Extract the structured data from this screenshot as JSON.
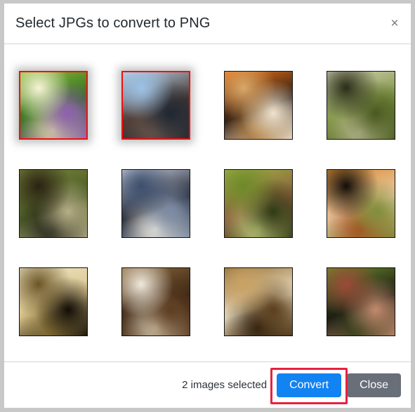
{
  "window": {
    "frame_color": "#c8c8c8",
    "background": "#ffffff"
  },
  "header": {
    "title": "Select JPGs to convert to PNG",
    "close_icon": "×",
    "close_icon_name": "close-icon",
    "separator_color": "#d5d5d5"
  },
  "body": {
    "columns": 4,
    "rows": 3,
    "thumbnails": [
      {
        "index": 1,
        "alt": "purple flower spike with green foliage",
        "selected": true,
        "palette": [
          "#f7f3d8",
          "#8bbf3a",
          "#2f6b1d",
          "#8e5fb0",
          "#dcd7a6"
        ]
      },
      {
        "index": 2,
        "alt": "cormorant bird perched in bare tree against blue sky",
        "selected": true,
        "palette": [
          "#9cc2e6",
          "#b8d2ea",
          "#4a3a33",
          "#1d2733",
          "#6f5a4e"
        ]
      },
      {
        "index": 3,
        "alt": "orange fruit on reflective table in blurred interior",
        "selected": false,
        "palette": [
          "#d8a86a",
          "#f07818",
          "#2a1a12",
          "#efe3cf",
          "#b07c3c"
        ]
      },
      {
        "index": 4,
        "alt": "fountain in a pond with grassy banks",
        "selected": false,
        "palette": [
          "#2a2d18",
          "#d8d6bc",
          "#7d9240",
          "#49591f",
          "#bcbb94"
        ]
      },
      {
        "index": 5,
        "alt": "wooded pond with dark tree trunks",
        "selected": false,
        "palette": [
          "#2a2213",
          "#79853c",
          "#4c5b26",
          "#b6ae86",
          "#1a1a14"
        ]
      },
      {
        "index": 6,
        "alt": "sun behind bare branches over water at dusk",
        "selected": false,
        "palette": [
          "#3c4f6e",
          "#cfd6e4",
          "#1d2230",
          "#7d8ca5",
          "#f4efe2"
        ]
      },
      {
        "index": 7,
        "alt": "green reed stems over brick wall",
        "selected": false,
        "palette": [
          "#6e8a2a",
          "#9fb545",
          "#8b5e3c",
          "#2f3a15",
          "#c4cf7e"
        ]
      },
      {
        "index": 8,
        "alt": "grilled salmon with vegetables on dark plate",
        "selected": false,
        "palette": [
          "#120d08",
          "#d98b33",
          "#e8c9a0",
          "#7f8f3a",
          "#a8471c"
        ]
      },
      {
        "index": 9,
        "alt": "pendant lamp shade glowing in dark room",
        "selected": false,
        "palette": [
          "#6a5526",
          "#f0e6c6",
          "#d9c58e",
          "#120d06",
          "#8a7236"
        ]
      },
      {
        "index": 10,
        "alt": "wooden chair leg and seat close-up",
        "selected": false,
        "palette": [
          "#efe9dd",
          "#8c6a3c",
          "#3b2414",
          "#5e3d20",
          "#d6c9ae"
        ]
      },
      {
        "index": 11,
        "alt": "stacked pages of an open old book",
        "selected": false,
        "palette": [
          "#c9a264",
          "#8f6a32",
          "#efe2c4",
          "#5c3f1c",
          "#2a1c0c"
        ]
      },
      {
        "index": 12,
        "alt": "lizard on a brick ledge with green grass behind",
        "selected": false,
        "palette": [
          "#9b4b38",
          "#6f8d2c",
          "#1a1a14",
          "#c28a6c",
          "#2b3a16"
        ]
      }
    ]
  },
  "footer": {
    "selection_count_text": "2 images selected",
    "convert_label": "Convert",
    "close_label": "Close",
    "convert_color": "#1283f2",
    "close_color": "#696f78",
    "highlight_color": "#e8213f"
  }
}
